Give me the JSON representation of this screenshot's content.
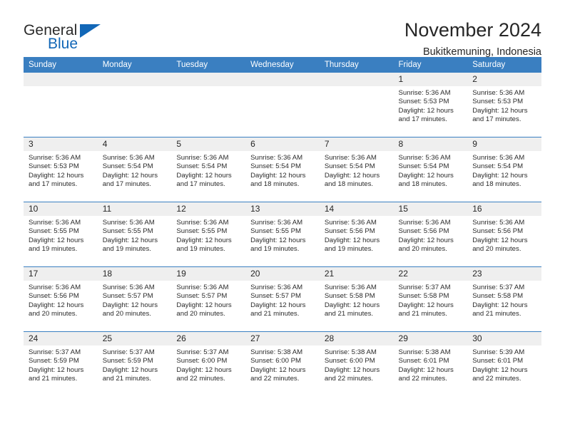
{
  "brand": {
    "name_part1": "General",
    "name_part2": "Blue",
    "accent_color": "#1267b7"
  },
  "header": {
    "title": "November 2024",
    "location": "Bukitkemuning, Indonesia"
  },
  "calendar": {
    "header_background": "#3a7fc1",
    "daynum_background": "#efefef",
    "weekday_headers": [
      "Sunday",
      "Monday",
      "Tuesday",
      "Wednesday",
      "Thursday",
      "Friday",
      "Saturday"
    ],
    "weeks": [
      [
        {
          "day": "",
          "empty": true
        },
        {
          "day": "",
          "empty": true
        },
        {
          "day": "",
          "empty": true
        },
        {
          "day": "",
          "empty": true
        },
        {
          "day": "",
          "empty": true
        },
        {
          "day": "1",
          "sunrise": "Sunrise: 5:36 AM",
          "sunset": "Sunset: 5:53 PM",
          "daylight_line1": "Daylight: 12 hours",
          "daylight_line2": "and 17 minutes."
        },
        {
          "day": "2",
          "sunrise": "Sunrise: 5:36 AM",
          "sunset": "Sunset: 5:53 PM",
          "daylight_line1": "Daylight: 12 hours",
          "daylight_line2": "and 17 minutes."
        }
      ],
      [
        {
          "day": "3",
          "sunrise": "Sunrise: 5:36 AM",
          "sunset": "Sunset: 5:53 PM",
          "daylight_line1": "Daylight: 12 hours",
          "daylight_line2": "and 17 minutes."
        },
        {
          "day": "4",
          "sunrise": "Sunrise: 5:36 AM",
          "sunset": "Sunset: 5:54 PM",
          "daylight_line1": "Daylight: 12 hours",
          "daylight_line2": "and 17 minutes."
        },
        {
          "day": "5",
          "sunrise": "Sunrise: 5:36 AM",
          "sunset": "Sunset: 5:54 PM",
          "daylight_line1": "Daylight: 12 hours",
          "daylight_line2": "and 17 minutes."
        },
        {
          "day": "6",
          "sunrise": "Sunrise: 5:36 AM",
          "sunset": "Sunset: 5:54 PM",
          "daylight_line1": "Daylight: 12 hours",
          "daylight_line2": "and 18 minutes."
        },
        {
          "day": "7",
          "sunrise": "Sunrise: 5:36 AM",
          "sunset": "Sunset: 5:54 PM",
          "daylight_line1": "Daylight: 12 hours",
          "daylight_line2": "and 18 minutes."
        },
        {
          "day": "8",
          "sunrise": "Sunrise: 5:36 AM",
          "sunset": "Sunset: 5:54 PM",
          "daylight_line1": "Daylight: 12 hours",
          "daylight_line2": "and 18 minutes."
        },
        {
          "day": "9",
          "sunrise": "Sunrise: 5:36 AM",
          "sunset": "Sunset: 5:54 PM",
          "daylight_line1": "Daylight: 12 hours",
          "daylight_line2": "and 18 minutes."
        }
      ],
      [
        {
          "day": "10",
          "sunrise": "Sunrise: 5:36 AM",
          "sunset": "Sunset: 5:55 PM",
          "daylight_line1": "Daylight: 12 hours",
          "daylight_line2": "and 19 minutes."
        },
        {
          "day": "11",
          "sunrise": "Sunrise: 5:36 AM",
          "sunset": "Sunset: 5:55 PM",
          "daylight_line1": "Daylight: 12 hours",
          "daylight_line2": "and 19 minutes."
        },
        {
          "day": "12",
          "sunrise": "Sunrise: 5:36 AM",
          "sunset": "Sunset: 5:55 PM",
          "daylight_line1": "Daylight: 12 hours",
          "daylight_line2": "and 19 minutes."
        },
        {
          "day": "13",
          "sunrise": "Sunrise: 5:36 AM",
          "sunset": "Sunset: 5:55 PM",
          "daylight_line1": "Daylight: 12 hours",
          "daylight_line2": "and 19 minutes."
        },
        {
          "day": "14",
          "sunrise": "Sunrise: 5:36 AM",
          "sunset": "Sunset: 5:56 PM",
          "daylight_line1": "Daylight: 12 hours",
          "daylight_line2": "and 19 minutes."
        },
        {
          "day": "15",
          "sunrise": "Sunrise: 5:36 AM",
          "sunset": "Sunset: 5:56 PM",
          "daylight_line1": "Daylight: 12 hours",
          "daylight_line2": "and 20 minutes."
        },
        {
          "day": "16",
          "sunrise": "Sunrise: 5:36 AM",
          "sunset": "Sunset: 5:56 PM",
          "daylight_line1": "Daylight: 12 hours",
          "daylight_line2": "and 20 minutes."
        }
      ],
      [
        {
          "day": "17",
          "sunrise": "Sunrise: 5:36 AM",
          "sunset": "Sunset: 5:56 PM",
          "daylight_line1": "Daylight: 12 hours",
          "daylight_line2": "and 20 minutes."
        },
        {
          "day": "18",
          "sunrise": "Sunrise: 5:36 AM",
          "sunset": "Sunset: 5:57 PM",
          "daylight_line1": "Daylight: 12 hours",
          "daylight_line2": "and 20 minutes."
        },
        {
          "day": "19",
          "sunrise": "Sunrise: 5:36 AM",
          "sunset": "Sunset: 5:57 PM",
          "daylight_line1": "Daylight: 12 hours",
          "daylight_line2": "and 20 minutes."
        },
        {
          "day": "20",
          "sunrise": "Sunrise: 5:36 AM",
          "sunset": "Sunset: 5:57 PM",
          "daylight_line1": "Daylight: 12 hours",
          "daylight_line2": "and 21 minutes."
        },
        {
          "day": "21",
          "sunrise": "Sunrise: 5:36 AM",
          "sunset": "Sunset: 5:58 PM",
          "daylight_line1": "Daylight: 12 hours",
          "daylight_line2": "and 21 minutes."
        },
        {
          "day": "22",
          "sunrise": "Sunrise: 5:37 AM",
          "sunset": "Sunset: 5:58 PM",
          "daylight_line1": "Daylight: 12 hours",
          "daylight_line2": "and 21 minutes."
        },
        {
          "day": "23",
          "sunrise": "Sunrise: 5:37 AM",
          "sunset": "Sunset: 5:58 PM",
          "daylight_line1": "Daylight: 12 hours",
          "daylight_line2": "and 21 minutes."
        }
      ],
      [
        {
          "day": "24",
          "sunrise": "Sunrise: 5:37 AM",
          "sunset": "Sunset: 5:59 PM",
          "daylight_line1": "Daylight: 12 hours",
          "daylight_line2": "and 21 minutes."
        },
        {
          "day": "25",
          "sunrise": "Sunrise: 5:37 AM",
          "sunset": "Sunset: 5:59 PM",
          "daylight_line1": "Daylight: 12 hours",
          "daylight_line2": "and 21 minutes."
        },
        {
          "day": "26",
          "sunrise": "Sunrise: 5:37 AM",
          "sunset": "Sunset: 6:00 PM",
          "daylight_line1": "Daylight: 12 hours",
          "daylight_line2": "and 22 minutes."
        },
        {
          "day": "27",
          "sunrise": "Sunrise: 5:38 AM",
          "sunset": "Sunset: 6:00 PM",
          "daylight_line1": "Daylight: 12 hours",
          "daylight_line2": "and 22 minutes."
        },
        {
          "day": "28",
          "sunrise": "Sunrise: 5:38 AM",
          "sunset": "Sunset: 6:00 PM",
          "daylight_line1": "Daylight: 12 hours",
          "daylight_line2": "and 22 minutes."
        },
        {
          "day": "29",
          "sunrise": "Sunrise: 5:38 AM",
          "sunset": "Sunset: 6:01 PM",
          "daylight_line1": "Daylight: 12 hours",
          "daylight_line2": "and 22 minutes."
        },
        {
          "day": "30",
          "sunrise": "Sunrise: 5:39 AM",
          "sunset": "Sunset: 6:01 PM",
          "daylight_line1": "Daylight: 12 hours",
          "daylight_line2": "and 22 minutes."
        }
      ]
    ]
  }
}
